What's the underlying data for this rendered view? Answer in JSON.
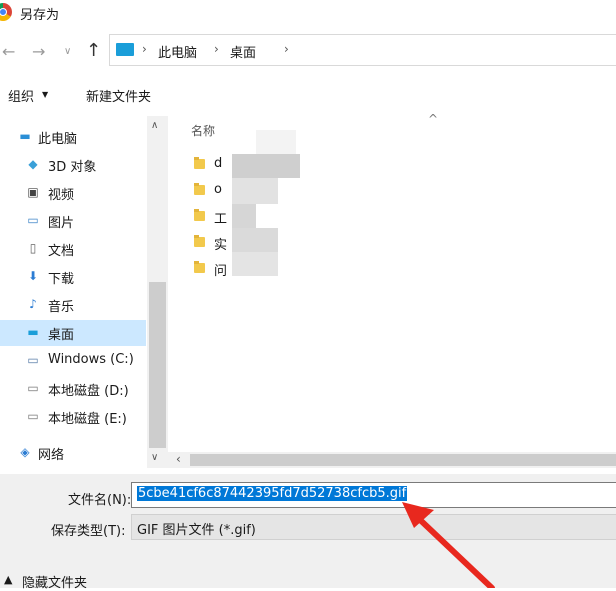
{
  "window": {
    "title": "另存为"
  },
  "address": {
    "crumbs": [
      "此电脑",
      "桌面"
    ]
  },
  "toolbar": {
    "organize": "组织",
    "new_folder": "新建文件夹"
  },
  "nav": {
    "items": [
      {
        "label": "此电脑",
        "icon": "computer-icon"
      },
      {
        "label": "3D 对象",
        "icon": "cube-icon"
      },
      {
        "label": "视频",
        "icon": "video-icon"
      },
      {
        "label": "图片",
        "icon": "picture-icon"
      },
      {
        "label": "文档",
        "icon": "document-icon"
      },
      {
        "label": "下载",
        "icon": "download-icon"
      },
      {
        "label": "音乐",
        "icon": "music-icon"
      },
      {
        "label": "桌面",
        "icon": "desktop-icon",
        "selected": true
      },
      {
        "label": "Windows (C:)",
        "icon": "drive-icon"
      },
      {
        "label": "本地磁盘 (D:)",
        "icon": "drive-icon"
      },
      {
        "label": "本地磁盘 (E:)",
        "icon": "drive-icon"
      },
      {
        "label": "网络",
        "icon": "network-icon"
      }
    ]
  },
  "files": {
    "column_name": "名称",
    "items": [
      "d",
      "o",
      "工",
      "实",
      "问"
    ]
  },
  "form": {
    "filename_label": "文件名(N):",
    "filename_value": "5cbe41cf6c87442395fd7d52738cfcb5.gif",
    "filetype_label": "保存类型(T):",
    "filetype_value": "GIF 图片文件 (*.gif)",
    "hide_folders": "隐藏文件夹"
  },
  "colors": {
    "accent": "#0078d7",
    "annotation": "#e8281e"
  }
}
